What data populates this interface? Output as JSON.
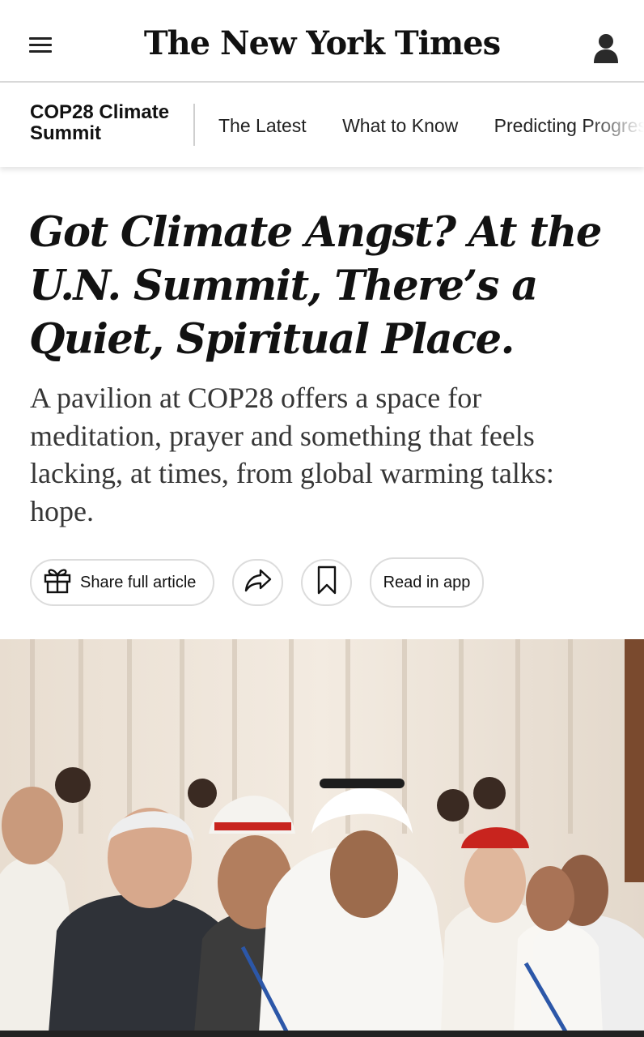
{
  "header": {
    "masthead": "The New York Times",
    "menu_icon": "hamburger-menu-icon",
    "user_icon": "user-account-icon"
  },
  "section_nav": {
    "title": "COP28 Climate Summit",
    "links": [
      "The Latest",
      "What to Know",
      "Predicting Progress"
    ]
  },
  "article": {
    "headline": "Got Climate Angst? At the U.N. Summit, There’s a Quiet, Spiritual Place.",
    "summary": "A pavilion at COP28 offers a space for meditation, prayer and something that feels lacking, at times, from global warming talks: hope."
  },
  "actions": {
    "share_full": "Share full article",
    "share_full_icon": "gift-icon",
    "share_icon": "share-arrow-icon",
    "bookmark_icon": "bookmark-icon",
    "read_in_app": "Read in app"
  },
  "colors": {
    "text": "#121212",
    "summary": "#363636",
    "border": "#dcdcdc",
    "cardinal_red": "#c8241e"
  }
}
